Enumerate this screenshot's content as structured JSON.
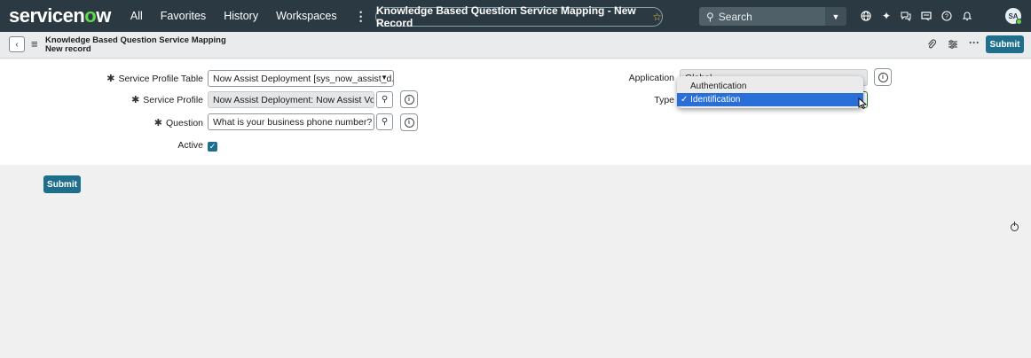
{
  "nav": {
    "logo_text": "servicenow",
    "links": [
      "All",
      "Favorites",
      "History",
      "Workspaces"
    ],
    "more": "⋮",
    "record_title": "Knowledge Based Question Service Mapping - New Record",
    "search_placeholder": "Search",
    "avatar_initials": "SA"
  },
  "header": {
    "title_line1": "Knowledge Based Question Service Mapping",
    "title_line2": "New record",
    "submit_label": "Submit"
  },
  "form": {
    "service_profile_table": {
      "label": "Service Profile Table",
      "value": "Now Assist Deployment [sys_now_assist_d..."
    },
    "service_profile": {
      "label": "Service Profile",
      "value": "Now Assist Deployment: Now Assist Voice D"
    },
    "question": {
      "label": "Question",
      "value": "What is your business phone number?"
    },
    "active": {
      "label": "Active",
      "checked": true
    },
    "application": {
      "label": "Application",
      "value": "Global"
    },
    "type": {
      "label": "Type",
      "options": [
        "Authentication",
        "Identification"
      ],
      "selected": "Identification"
    }
  },
  "footer": {
    "submit_label": "Submit"
  },
  "colors": {
    "nav_bg": "#2b3a42",
    "primary": "#1f6e8c",
    "select_highlight": "#2a6fd8",
    "logo_accent": "#62d84e"
  }
}
